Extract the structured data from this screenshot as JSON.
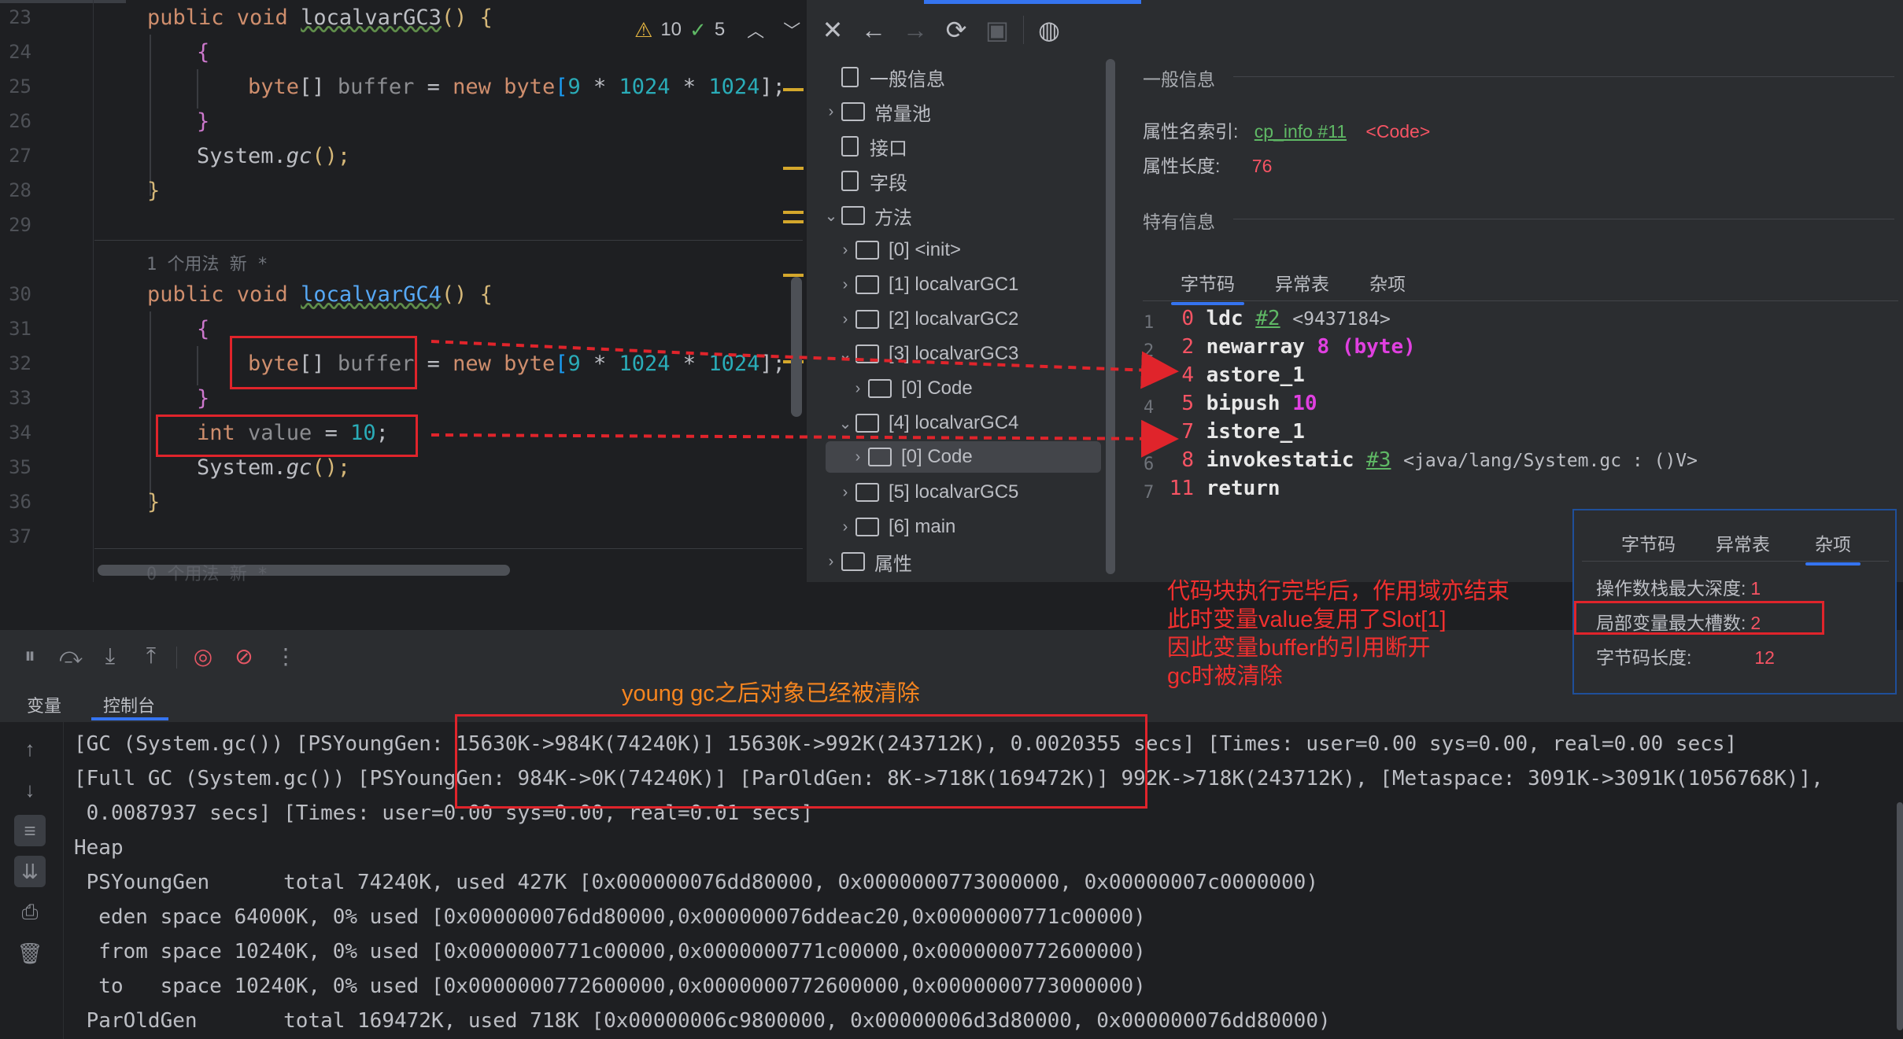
{
  "editor": {
    "line_numbers": [
      "23",
      "24",
      "25",
      "26",
      "27",
      "28",
      "29",
      "30",
      "31",
      "32",
      "33",
      "34",
      "35",
      "36",
      "37"
    ],
    "inspection": {
      "warnings": "10",
      "ok": "5"
    },
    "hint_usage": "1 个用法   新 *",
    "hint_usage_bottom": "0 个用法   新 *",
    "lines": {
      "l23": {
        "kw": "public void ",
        "fn": "localvarGC3",
        "rest": "() {"
      },
      "l24": "{",
      "l25": {
        "kw": "byte",
        "t1": "[] ",
        "var": "buffer",
        "t2": " = ",
        "kw2": "new ",
        "kw3": "byte",
        "t3": "[",
        "n1": "9",
        "t4": " * ",
        "n2": "1024",
        "t5": " * ",
        "n3": "1024",
        "t6": "];"
      },
      "l26": "}",
      "l27": {
        "a": "System.",
        "b": "gc",
        "c": "();"
      },
      "l28": "}",
      "l30": {
        "kw": "public void ",
        "fn": "localvarGC4",
        "rest": "() {"
      },
      "l31": "{",
      "l32": {
        "kw": "byte",
        "t1": "[] ",
        "var": "buffer",
        "t2": " = ",
        "kw2": "new ",
        "kw3": "byte",
        "t3": "[",
        "n1": "9",
        "t4": " * ",
        "n2": "1024",
        "t5": " * ",
        "n3": "1024",
        "t6": "];"
      },
      "l33": "}",
      "l34": {
        "kw": "int ",
        "var": "value",
        "t1": " = ",
        "n": "10",
        "t2": ";"
      },
      "l35": {
        "a": "System.",
        "b": "gc",
        "c": "();"
      },
      "l36": "}"
    }
  },
  "tree": {
    "items": [
      {
        "label": "一般信息",
        "icon": "file-icon"
      },
      {
        "label": "常量池",
        "icon": "folder-icon"
      },
      {
        "label": "接口",
        "icon": "file-icon"
      },
      {
        "label": "字段",
        "icon": "file-icon"
      },
      {
        "label": "方法",
        "icon": "folder-icon"
      },
      {
        "label": "[0] <init>",
        "icon": "folder-icon"
      },
      {
        "label": "[1] localvarGC1",
        "icon": "folder-icon"
      },
      {
        "label": "[2] localvarGC2",
        "icon": "folder-icon"
      },
      {
        "label": "[3] localvarGC3",
        "icon": "folder-icon"
      },
      {
        "label": "[0] Code",
        "icon": "folder-icon"
      },
      {
        "label": "[4] localvarGC4",
        "icon": "folder-icon"
      },
      {
        "label": "[0] Code",
        "icon": "folder-icon"
      },
      {
        "label": "[5] localvarGC5",
        "icon": "folder-icon"
      },
      {
        "label": "[6] main",
        "icon": "folder-icon"
      },
      {
        "label": "属性",
        "icon": "folder-icon"
      }
    ]
  },
  "info": {
    "general_title": "一般信息",
    "attr_name_label": "属性名索引:",
    "attr_name_link": "cp_info #11",
    "attr_name_value": "<Code>",
    "attr_len_label": "属性长度:",
    "attr_len_value": "76",
    "specific_title": "特有信息",
    "tabs": [
      "字节码",
      "异常表",
      "杂项"
    ]
  },
  "bytecode": [
    {
      "ln": "1",
      "off": "0",
      "op": "ldc",
      "ref": "#2",
      "cmt": "<9437184>"
    },
    {
      "ln": "2",
      "off": "2",
      "op": "newarray",
      "arg": "8 (byte)"
    },
    {
      "ln": "3",
      "off": "4",
      "op": "astore_1"
    },
    {
      "ln": "4",
      "off": "5",
      "op": "bipush",
      "arg": "10"
    },
    {
      "ln": "5",
      "off": "7",
      "op": "istore_1"
    },
    {
      "ln": "6",
      "off": "8",
      "op": "invokestatic",
      "ref": "#3",
      "cmt": "<java/lang/System.gc : ()V>"
    },
    {
      "ln": "7",
      "off": "11",
      "op": "return"
    }
  ],
  "popup": {
    "tabs": [
      "字节码",
      "异常表",
      "杂项"
    ],
    "max_stack_label": "操作数栈最大深度:",
    "max_stack_value": "1",
    "max_locals_label": "局部变量最大槽数:",
    "max_locals_value": "2",
    "code_len_label": "字节码长度:",
    "code_len_value": "12"
  },
  "annotations": {
    "scope_note": "代码块执行完毕后，作用域亦结束\n此时变量value复用了Slot[1]\n因此变量buffer的引用断开\ngc时被清除",
    "young_gc_note": "young gc之后对象已经被清除"
  },
  "console_tabs": [
    "变量",
    "控制台"
  ],
  "console_lines": [
    "[GC (System.gc()) [PSYoungGen: 15630K->984K(74240K)] 15630K->992K(243712K), 0.0020355 secs] [Times: user=0.00 sys=0.00, real=0.00 secs]",
    "[Full GC (System.gc()) [PSYoungGen: 984K->0K(74240K)] [ParOldGen: 8K->718K(169472K)] 992K->718K(243712K), [Metaspace: 3091K->3091K(1056768K)],",
    " 0.0087937 secs] [Times: user=0.00 sys=0.00, real=0.01 secs]",
    "Heap",
    " PSYoungGen      total 74240K, used 427K [0x000000076dd80000, 0x0000000773000000, 0x00000007c0000000)",
    "  eden space 64000K, 0% used [0x000000076dd80000,0x000000076ddeac20,0x0000000771c00000)",
    "  from space 10240K, 0% used [0x0000000771c00000,0x0000000771c00000,0x0000000772600000)",
    "  to   space 10240K, 0% used [0x0000000772600000,0x0000000772600000,0x0000000773000000)",
    " ParOldGen       total 169472K, used 718K [0x00000006c9800000, 0x00000006d3d80000, 0x000000076dd80000)"
  ],
  "colors": {
    "accent": "#3574f0",
    "annotation_red": "#e0242b"
  }
}
